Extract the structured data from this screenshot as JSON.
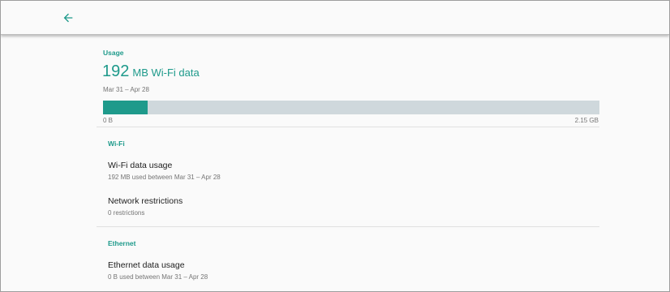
{
  "toolbar": {
    "back_icon": "arrow-back-icon"
  },
  "usage": {
    "header": "Usage",
    "amount": "192",
    "unit_label": "MB Wi-Fi data",
    "date_range": "Mar 31 – Apr 28",
    "bar": {
      "min_label": "0 B",
      "max_label": "2.15 GB",
      "used_fraction": 0.09,
      "fill_color": "#1e9a8b",
      "track_color": "#cfd8dc"
    }
  },
  "wifi": {
    "header": "Wi-Fi",
    "items": [
      {
        "title": "Wi-Fi data usage",
        "summary": "192 MB used between Mar 31 – Apr 28"
      },
      {
        "title": "Network restrictions",
        "summary": "0 restrictions"
      }
    ]
  },
  "ethernet": {
    "header": "Ethernet",
    "items": [
      {
        "title": "Ethernet data usage",
        "summary": "0 B used between Mar 31 – Apr 28"
      }
    ]
  },
  "colors": {
    "accent": "#1e9a8b"
  }
}
